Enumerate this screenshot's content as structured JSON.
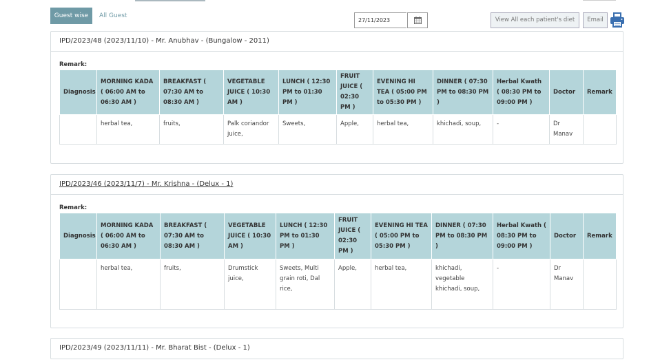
{
  "tabs": {
    "active": "Guest wise",
    "other": "All Guest"
  },
  "filter": {
    "date_value": "27/11/2023"
  },
  "actions": {
    "view_all_label": "View All each patient's diet",
    "email_label": "Email"
  },
  "columns": [
    "Diagnosis",
    "MORNING KADA ( 06:00 AM to 06:30 AM )",
    "BREAKFAST ( 07:30 AM to 08:30 AM )",
    "VEGETABLE JUICE ( 10:30 AM )",
    "LUNCH ( 12:30 PM to 01:30 PM )",
    "FRUIT JUICE ( 02:30 PM )",
    "EVENING HI TEA ( 05:00 PM to 05:30 PM )",
    "DINNER ( 07:30 PM to 08:30 PM )",
    "Herbal Kwath ( 08:30 PM to 09:00 PM )",
    "Doctor",
    "Remark"
  ],
  "remark_label": "Remark:",
  "patients": [
    {
      "title": "IPD/2023/48 (2023/11/10) - Mr. Anubhav - (Bungalow - 2011)",
      "row": {
        "diagnosis": "",
        "morning_kada": "herbal tea,",
        "breakfast": "fruits,",
        "vegetable_juice": "Palk coriandor juice,",
        "lunch": "Sweets,",
        "fruit_juice": "Apple,",
        "evening_hi_tea": "herbal tea,",
        "dinner": "khichadi, soup,",
        "herbal_kwath": "-",
        "doctor": "Dr Manav",
        "remark": ""
      }
    },
    {
      "title": "IPD/2023/46 (2023/11/7) - Mr. Krishna - (Delux - 1)",
      "row": {
        "diagnosis": "",
        "morning_kada": "herbal tea,",
        "breakfast": "fruits,",
        "vegetable_juice": "Drumstick juice,",
        "lunch": "Sweets, Multi grain roti, Dal rice,",
        "fruit_juice": "Apple,",
        "evening_hi_tea": "herbal tea,",
        "dinner": "khichadi, vegetable khichadi, soup,",
        "herbal_kwath": "-",
        "doctor": "Dr Manav",
        "remark": ""
      }
    },
    {
      "title": "IPD/2023/49 (2023/11/11) - Mr. Bharat Bist - (Delux - 1)"
    }
  ],
  "colors": {
    "accent": "#6f9aa6",
    "table_header": "#b4d5da",
    "print_icon": "#3a6fb0"
  }
}
